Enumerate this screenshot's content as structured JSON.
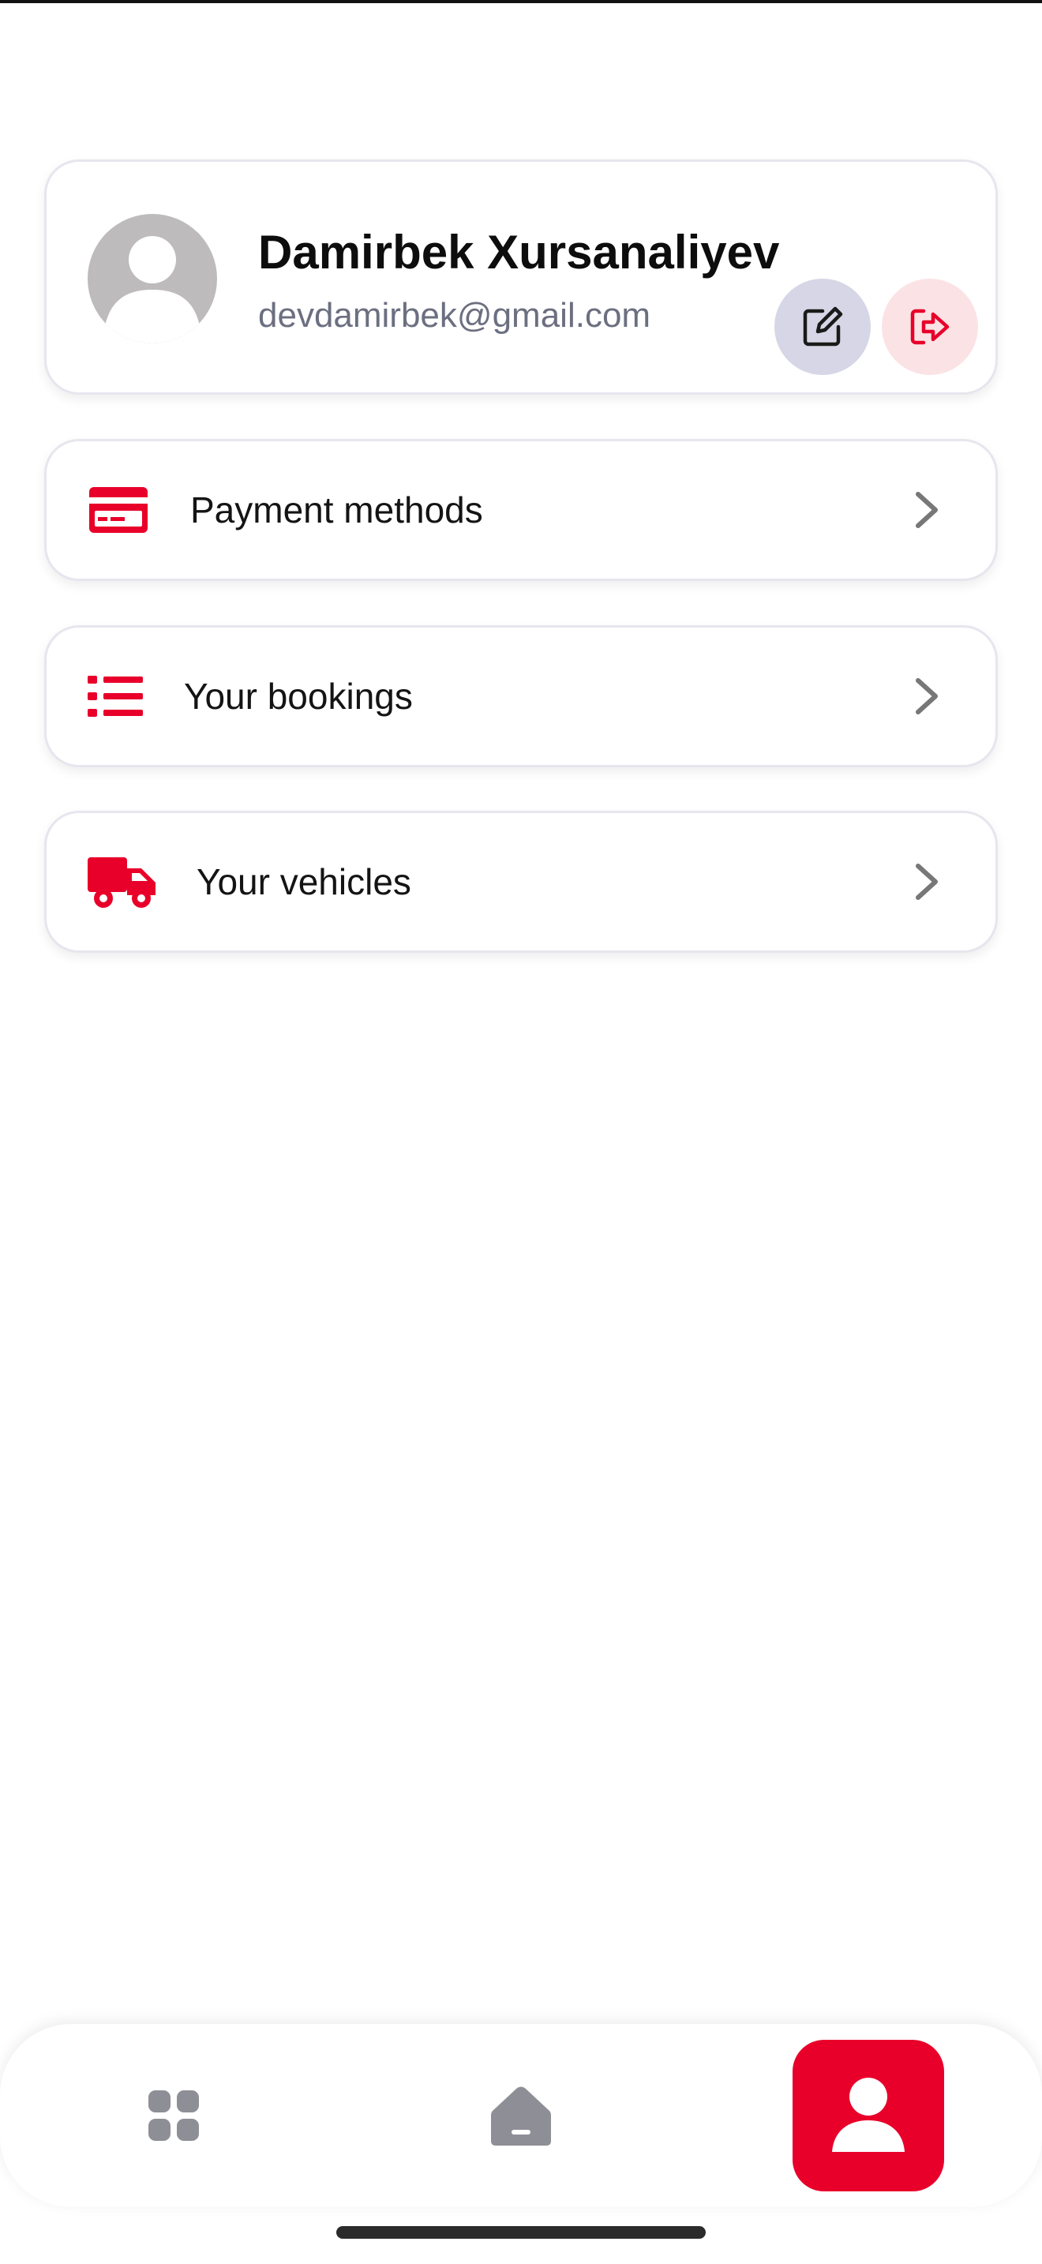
{
  "profile": {
    "name": "Damirbek Xursanaliyev",
    "email": "devdamirbek@gmail.com"
  },
  "icons": {
    "avatar": "user-avatar-icon",
    "edit": "edit-square-icon",
    "logout": "logout-icon",
    "payment": "credit-card-icon",
    "bookings": "list-icon",
    "vehicles": "truck-icon",
    "chevron": "chevron-right-icon",
    "nav_grid": "grid-icon",
    "nav_home": "home-icon",
    "nav_profile": "user-icon"
  },
  "menu": {
    "items": [
      {
        "label": "Payment methods"
      },
      {
        "label": "Your bookings"
      },
      {
        "label": "Your vehicles"
      }
    ]
  },
  "colors": {
    "accent": "#e8002a",
    "edit_bg": "#d6d6e6",
    "logout_bg": "#fbe3e5",
    "nav_inactive": "#8e8e96",
    "email_text": "#6b6f80"
  }
}
